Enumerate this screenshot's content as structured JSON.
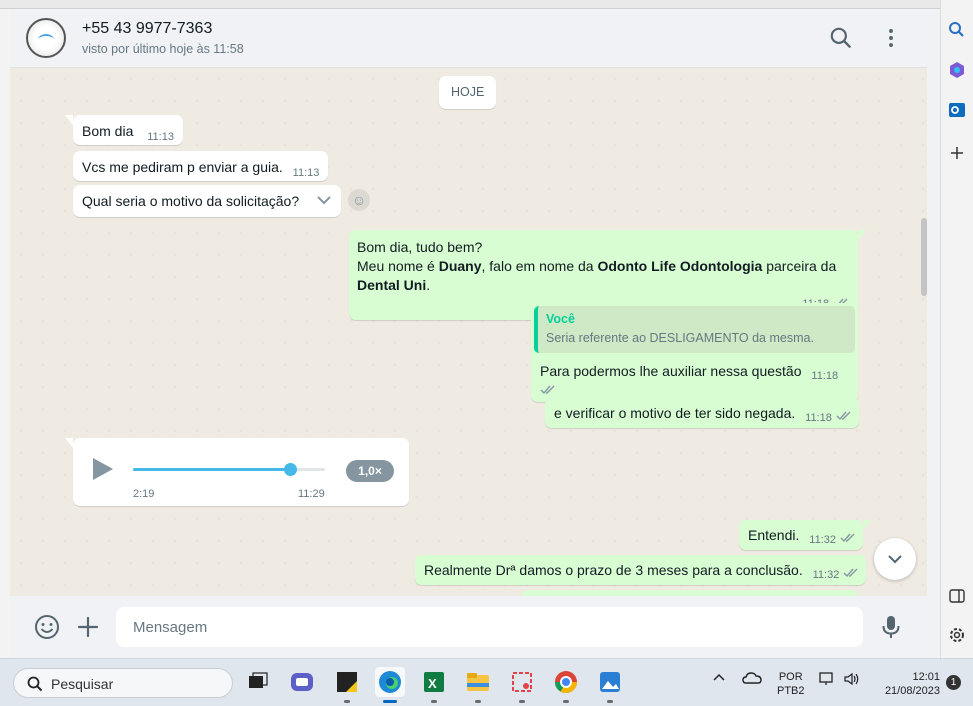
{
  "header": {
    "contact_name": "+55 43 9977-7363",
    "last_seen": "visto por último hoje às 11:58",
    "search_icon": "search-icon",
    "menu_icon": "kebab-menu-icon"
  },
  "chat": {
    "date_divider": "HOJE",
    "messages": [
      {
        "direction": "in",
        "text": "Bom dia",
        "time": "11:13"
      },
      {
        "direction": "in",
        "text": "Vcs me pediram p enviar a guia.",
        "time": "11:13"
      },
      {
        "direction": "in",
        "text": "Qual seria o motivo da solicitação?",
        "time": ""
      },
      {
        "direction": "out",
        "line1": "Bom dia, tudo bem?",
        "line2_pre": "Meu nome é ",
        "line2_bold1": "Duany",
        "line2_mid": ", falo em nome da ",
        "line2_bold2": "Odonto Life Odontologia",
        "line2_post": " parceira da",
        "line3_bold": "Dental Uni",
        "line3_post": ".",
        "time": "11:18"
      },
      {
        "direction": "out",
        "quote_author": "Você",
        "quote_text": "Seria referente ao DESLIGAMENTO da mesma.",
        "text": "Para podermos lhe auxiliar nessa questão",
        "time": "11:18"
      },
      {
        "direction": "out",
        "text": "e verificar o motivo de ter sido negada.",
        "time": "11:18"
      },
      {
        "direction": "in",
        "type": "voice",
        "duration": "2:19",
        "time": "11:29",
        "speed": "1,0×",
        "progress": 0.82
      },
      {
        "direction": "out",
        "text": "Entendi.",
        "time": "11:32"
      },
      {
        "direction": "out",
        "text": "Realmente Drª damos o prazo de 3 meses para a conclusão.",
        "time": "11:32"
      }
    ]
  },
  "compose": {
    "placeholder": "Mensagem"
  },
  "taskbar": {
    "search_placeholder": "Pesquisar",
    "lang_line1": "POR",
    "lang_line2": "PTB2",
    "time": "12:01",
    "date": "21/08/2023",
    "notifications": "1"
  },
  "colors": {
    "incoming_bubble": "#ffffff",
    "outgoing_bubble": "#d9fdd3",
    "chat_background": "#efeae2",
    "accent": "#06cf9c",
    "voice_progress": "#44b8e8"
  }
}
